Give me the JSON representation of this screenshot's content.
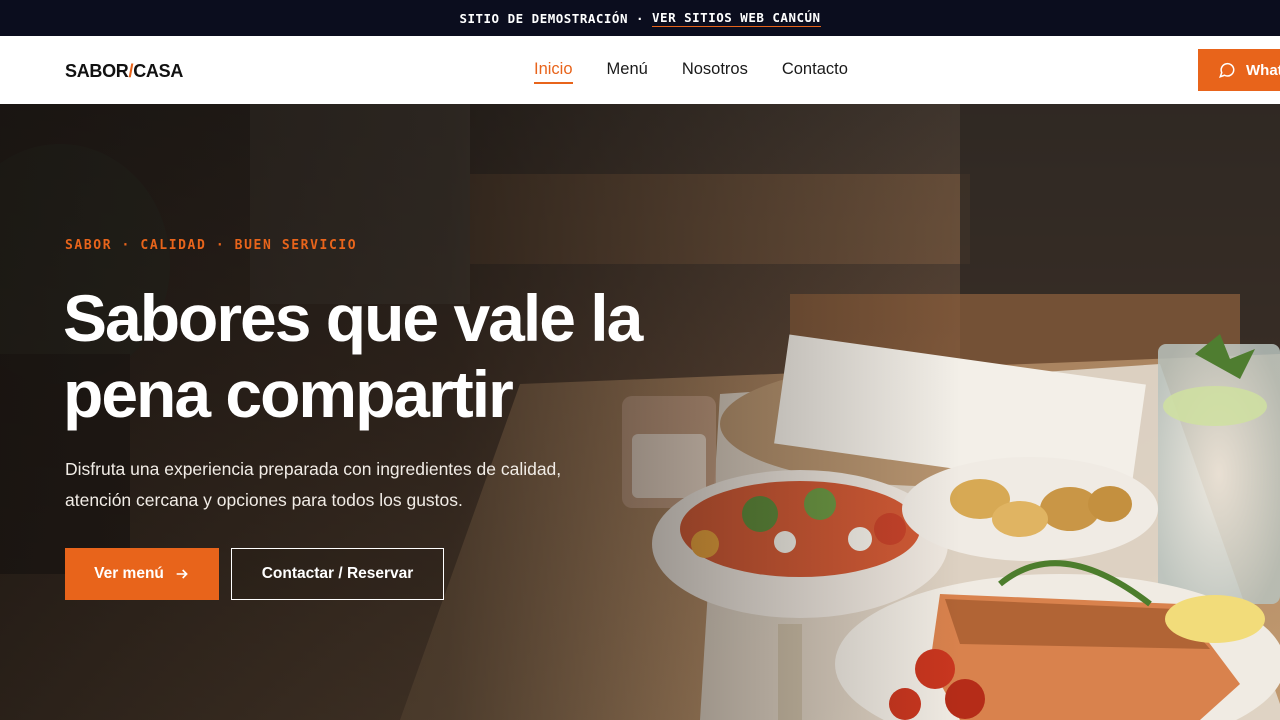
{
  "banner": {
    "demo_label": "SITIO DE DEMOSTRACIÓN",
    "separator": "·",
    "link_label": "VER SITIOS WEB CANCÚN"
  },
  "header": {
    "logo_left": "SABOR",
    "logo_slash": "/",
    "logo_right": "CASA",
    "nav": [
      {
        "label": "Inicio",
        "active": true
      },
      {
        "label": "Menú",
        "active": false
      },
      {
        "label": "Nosotros",
        "active": false
      },
      {
        "label": "Contacto",
        "active": false
      }
    ],
    "whatsapp_label": "What",
    "whatsapp_icon": "chat-bubble-icon"
  },
  "hero": {
    "eyebrow": "SABOR · CALIDAD · BUEN SERVICIO",
    "title": "Sabores que vale la pena compartir",
    "description": "Disfruta una experiencia preparada con ingredientes de calidad, atención cercana y opciones para todos los gustos.",
    "primary_button": "Ver menú",
    "primary_button_icon": "arrow-right-icon",
    "secondary_button": "Contactar / Reservar"
  },
  "colors": {
    "accent": "#e8641b",
    "banner_bg": "#0b0d1e",
    "header_bg": "#ffffff"
  }
}
